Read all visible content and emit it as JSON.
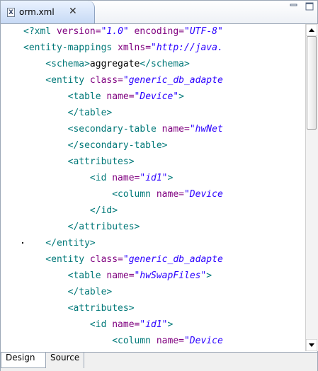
{
  "tab": {
    "title": "orm.xml",
    "file_icon": "X"
  },
  "code_lines": [
    [
      {
        "c": "t-tag",
        "t": "<?xml "
      },
      {
        "c": "t-attr",
        "t": "version="
      },
      {
        "c": "t-val",
        "t": "\"1.0\""
      },
      {
        "c": "t-attr",
        "t": " encoding="
      },
      {
        "c": "t-val",
        "t": "\"UTF-8\""
      }
    ],
    [
      {
        "c": "t-tag",
        "t": "<entity-mappings "
      },
      {
        "c": "t-attr",
        "t": "xmlns="
      },
      {
        "c": "t-val",
        "t": "\"http://java."
      }
    ],
    [
      {
        "c": "t-tag",
        "t": "    <schema>"
      },
      {
        "c": "t-txt",
        "t": "aggregate"
      },
      {
        "c": "t-tag",
        "t": "</schema>"
      }
    ],
    [
      {
        "c": "t-tag",
        "t": "    <entity "
      },
      {
        "c": "t-attr",
        "t": "class="
      },
      {
        "c": "t-val",
        "t": "\"generic_db_adapte"
      }
    ],
    [
      {
        "c": "t-tag",
        "t": "        <table "
      },
      {
        "c": "t-attr",
        "t": "name="
      },
      {
        "c": "t-val",
        "t": "\"Device\""
      },
      {
        "c": "t-tag",
        "t": ">"
      }
    ],
    [
      {
        "c": "t-tag",
        "t": "        </table>"
      }
    ],
    [
      {
        "c": "t-tag",
        "t": "        <secondary-table "
      },
      {
        "c": "t-attr",
        "t": "name="
      },
      {
        "c": "t-val",
        "t": "\"hwNet"
      }
    ],
    [
      {
        "c": "t-tag",
        "t": "        </secondary-table>"
      }
    ],
    [
      {
        "c": "t-tag",
        "t": "        <attributes>"
      }
    ],
    [
      {
        "c": "t-tag",
        "t": "            <id "
      },
      {
        "c": "t-attr",
        "t": "name="
      },
      {
        "c": "t-val",
        "t": "\"id1\""
      },
      {
        "c": "t-tag",
        "t": ">"
      }
    ],
    [
      {
        "c": "t-tag",
        "t": "                <column "
      },
      {
        "c": "t-attr",
        "t": "name="
      },
      {
        "c": "t-val",
        "t": "\"Device"
      }
    ],
    [
      {
        "c": "t-tag",
        "t": "            </id>"
      }
    ],
    [
      {
        "c": "t-tag",
        "t": "        </attributes>"
      }
    ],
    [
      {
        "c": "t-tag",
        "t": "    </entity>"
      }
    ],
    [
      {
        "c": "t-tag",
        "t": "    <entity "
      },
      {
        "c": "t-attr",
        "t": "class="
      },
      {
        "c": "t-val",
        "t": "\"generic_db_adapte"
      }
    ],
    [
      {
        "c": "t-tag",
        "t": "        <table "
      },
      {
        "c": "t-attr",
        "t": "name="
      },
      {
        "c": "t-val",
        "t": "\"hwSwapFiles\""
      },
      {
        "c": "t-tag",
        "t": ">"
      }
    ],
    [
      {
        "c": "t-tag",
        "t": "        </table>"
      }
    ],
    [
      {
        "c": "t-tag",
        "t": "        <attributes>"
      }
    ],
    [
      {
        "c": "t-tag",
        "t": "            <id "
      },
      {
        "c": "t-attr",
        "t": "name="
      },
      {
        "c": "t-val",
        "t": "\"id1\""
      },
      {
        "c": "t-tag",
        "t": ">"
      }
    ],
    [
      {
        "c": "t-tag",
        "t": "                <column "
      },
      {
        "c": "t-attr",
        "t": "name="
      },
      {
        "c": "t-val",
        "t": "\"Device"
      }
    ]
  ],
  "bottom_tabs": {
    "design": "Design",
    "source": "Source"
  },
  "icons": {
    "file": "xml-file-icon",
    "close": "close-icon",
    "minimize": "minimize-icon",
    "maximize": "maximize-icon"
  }
}
